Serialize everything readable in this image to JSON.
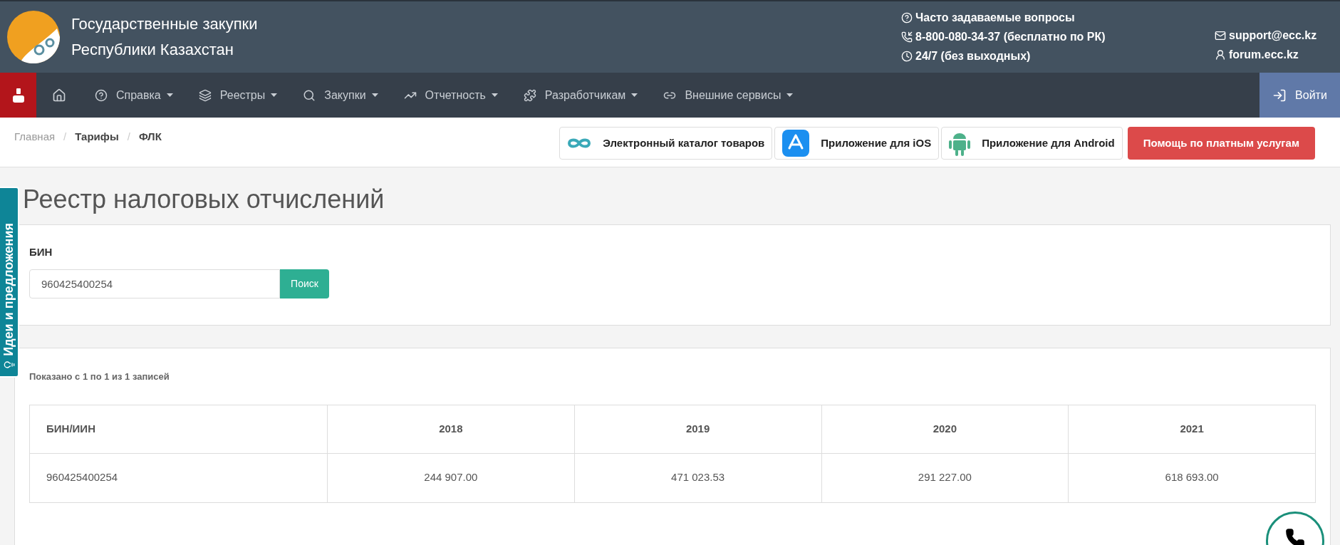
{
  "header": {
    "title_lines": [
      "Государственные закупки",
      "Республики Казахстан"
    ],
    "contacts": [
      {
        "kind": "question",
        "text": "Часто задаваемые вопросы"
      },
      {
        "kind": "phone",
        "text": "8-800-080-34-37 (бесплатно по РК)"
      },
      {
        "kind": "clock",
        "text": "24/7 (без выходных)"
      }
    ],
    "links": [
      {
        "kind": "mail",
        "text": "support@ecc.kz"
      },
      {
        "kind": "user",
        "text": "forum.ecc.kz"
      }
    ]
  },
  "nav": {
    "items": [
      {
        "kind": "help",
        "label": "Справка"
      },
      {
        "kind": "layers",
        "label": "Реестры"
      },
      {
        "kind": "search",
        "label": "Закупки"
      },
      {
        "kind": "chart",
        "label": "Отчетность"
      },
      {
        "kind": "puzzle",
        "label": "Разработчикам"
      },
      {
        "kind": "link",
        "label": "Внешние сервисы"
      }
    ],
    "login": "Войти"
  },
  "breadcrumb_separator": "/",
  "breadcrumb": [
    {
      "label": "Главная",
      "current": false
    },
    {
      "label": "Тарифы",
      "current": true
    },
    {
      "label": "ФЛК",
      "current": true
    }
  ],
  "quick_buttons": [
    {
      "kind": "catalog",
      "label": "Электронный каталог товаров"
    },
    {
      "kind": "ios",
      "label": "Приложение для iOS"
    },
    {
      "kind": "android",
      "label": "Приложение для Android"
    },
    {
      "kind": "help",
      "label": "Помощь по платным услугам"
    }
  ],
  "side_tab": "Идеи и предложения",
  "page_title": "Реестр налоговых отчислений",
  "search": {
    "label": "БИН",
    "value": "960425400254",
    "button": "Поиск"
  },
  "results": {
    "info": "Показано с 1 по 1 из 1 записей",
    "columns": [
      "БИН/ИИН",
      "2018",
      "2019",
      "2020",
      "2021"
    ],
    "rows": [
      [
        "960425400254",
        "244 907.00",
        "471 023.53",
        "291 227.00",
        "618 693.00"
      ]
    ]
  }
}
